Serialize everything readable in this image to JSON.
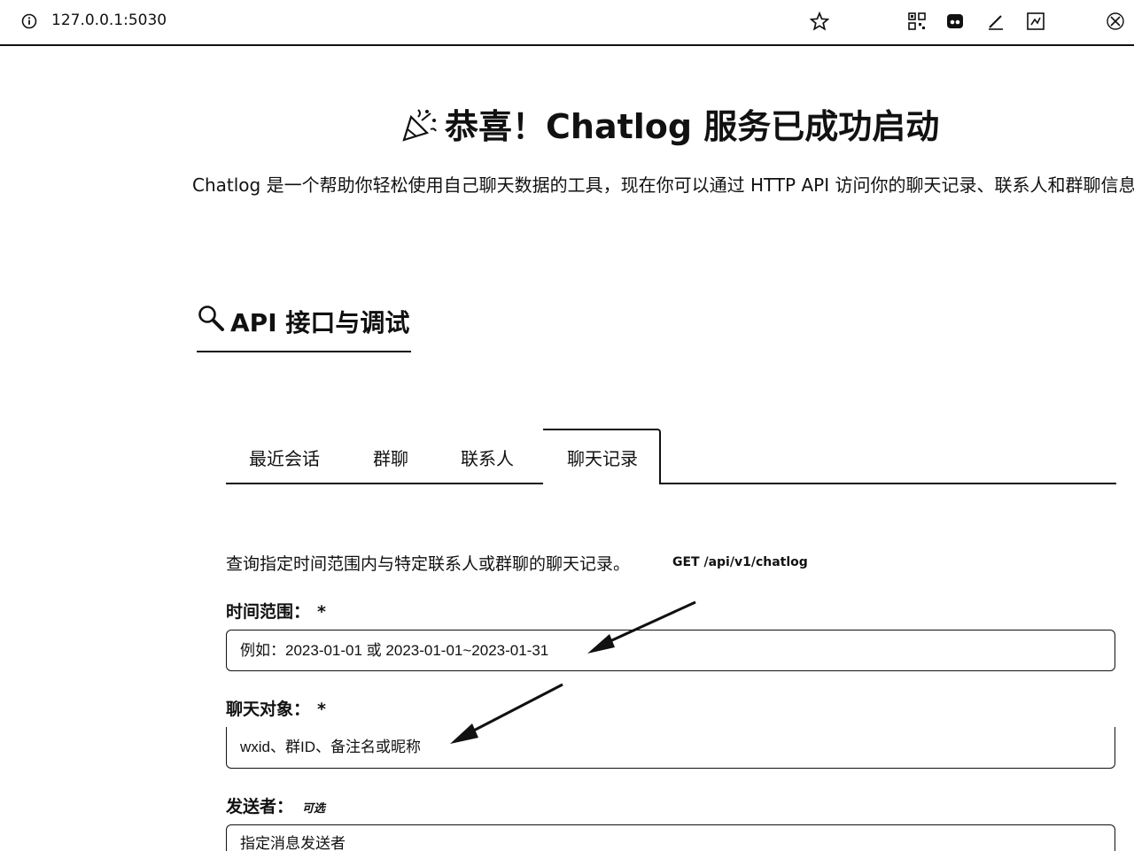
{
  "browser": {
    "url": "127.0.0.1:5030"
  },
  "page": {
    "headline": "恭喜！Chatlog 服务已成功启动",
    "subtitle": "Chatlog 是一个帮助你轻松使用自己聊天数据的工具，现在你可以通过 HTTP API 访问你的聊天记录、联系人和群聊信息。",
    "section_title": "API 接口与调试"
  },
  "tabs": [
    {
      "label": "最近会话"
    },
    {
      "label": "群聊"
    },
    {
      "label": "联系人"
    },
    {
      "label": "聊天记录",
      "active": true
    }
  ],
  "panel": {
    "description": "查询指定时间范围内与特定联系人或群聊的聊天记录。",
    "endpoint": "GET /api/v1/chatlog",
    "fields": [
      {
        "label": "时间范围：",
        "required": "*",
        "placeholder": "例如：2023-01-01 或 2023-01-01~2023-01-31"
      },
      {
        "label": "聊天对象：",
        "required": "*",
        "placeholder": "wxid、群ID、备注名或昵称"
      },
      {
        "label": "发送者：",
        "optional": "可选",
        "placeholder": "指定消息发送者"
      }
    ]
  },
  "icons": {
    "info": "info-icon",
    "star": "star-icon",
    "qr": "qr-code-icon",
    "extension": "extension-icon",
    "pen": "pen-icon",
    "screenshot": "screenshot-icon",
    "profile": "profile-icon",
    "party": "party-popper-icon",
    "search": "magnifier-icon"
  }
}
